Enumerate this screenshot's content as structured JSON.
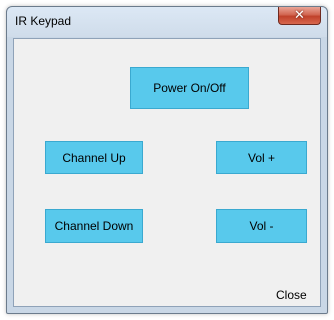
{
  "window": {
    "title": "IR Keypad",
    "close_glyph": "✕"
  },
  "buttons": {
    "power": "Power On/Off",
    "channel_up": "Channel Up",
    "vol_up": "Vol +",
    "channel_down": "Channel Down",
    "vol_down": "Vol -",
    "close": "Close"
  },
  "colors": {
    "button_fill": "#58c9ec",
    "close_button": "#c0412a"
  },
  "icons": {
    "window_close": "close-icon"
  }
}
